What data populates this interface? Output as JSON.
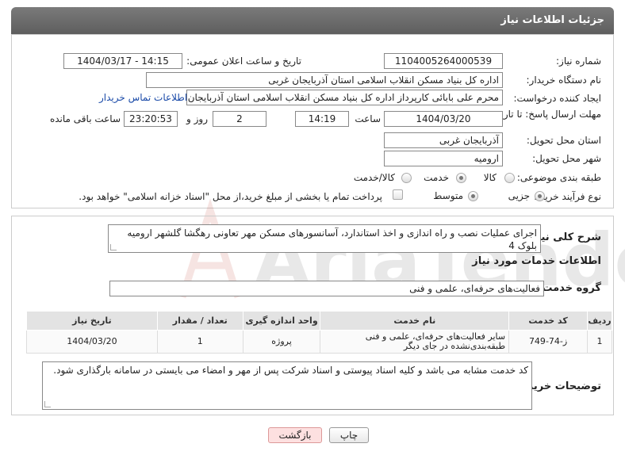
{
  "page_title": "جزئیات اطلاعات نیاز",
  "fields": {
    "need_number_label": "شماره نیاز:",
    "need_number": "1104005264000539",
    "announce_label": "تاریخ و ساعت اعلان عمومی:",
    "announce_value": "1404/03/17 - 14:15",
    "buyer_org_label": "نام دستگاه خریدار:",
    "buyer_org": "اداره کل بنیاد مسکن انقلاب اسلامی استان آذربایجان غربی",
    "creator_label": "ایجاد کننده درخواست:",
    "creator": "محرم علی بابائی کارپرداز اداره کل بنیاد مسکن انقلاب اسلامی استان آذربایجان",
    "contact_link": "اطلاعات تماس خریدار",
    "deadline_label": "مهلت ارسال پاسخ: تا تاریخ:",
    "deadline_date": "1404/03/20",
    "time_label": "ساعت",
    "deadline_time": "14:19",
    "days_value": "2",
    "days_label": "روز و",
    "remaining_time": "23:20:53",
    "remaining_label": "ساعت باقی مانده",
    "province_label": "استان محل تحویل:",
    "province": "آذربایجان غربی",
    "city_label": "شهر محل تحویل:",
    "city": "ارومیه",
    "category_label": "طبقه بندی موضوعی:",
    "category_options": [
      "کالا",
      "خدمت",
      "کالا/خدمت"
    ],
    "category_selected": "خدمت",
    "process_label": "نوع فرآیند خرید :",
    "process_options": [
      "جزیی",
      "متوسط"
    ],
    "process_selected": "جزیی",
    "payment_note": "پرداخت تمام یا بخشی از مبلغ خرید،از محل \"اسناد خزانه اسلامی\" خواهد بود."
  },
  "description": {
    "label": "شرح کلی نیاز:",
    "text": "اجرای عملیات نصب و راه اندازی و اخذ استاندارد، آسانسورهای مسکن مهر تعاونی رهگشا گلشهر ارومیه بلوک 4"
  },
  "services": {
    "section_title": "اطلاعات خدمات مورد نیاز",
    "group_label": "گروه خدمت:",
    "group_value": "فعالیت‌های حرفه‌ای، علمی و فنی",
    "columns": [
      "ردیف",
      "کد خدمت",
      "نام خدمت",
      "واحد اندازه گیری",
      "تعداد / مقدار",
      "تاریخ نیاز"
    ],
    "rows": [
      [
        "1",
        "ز-74-749",
        "سایر فعالیت‌های حرفه‌ای، علمی و فنی طبقه‌بندی‌نشده در جای دیگر",
        "پروژه",
        "1",
        "1404/03/20"
      ]
    ]
  },
  "buyer_notes": {
    "label": "توضیحات خریدار:",
    "text": "کد خدمت مشابه می باشد و کلیه اسناد پیوستی و اسناد شرکت پس از مهر و امضاء می بایستی در سامانه بارگذاری شود."
  },
  "buttons": {
    "print": "چاپ",
    "back": "بازگشت"
  },
  "watermark_text": "AriaTender.neT"
}
